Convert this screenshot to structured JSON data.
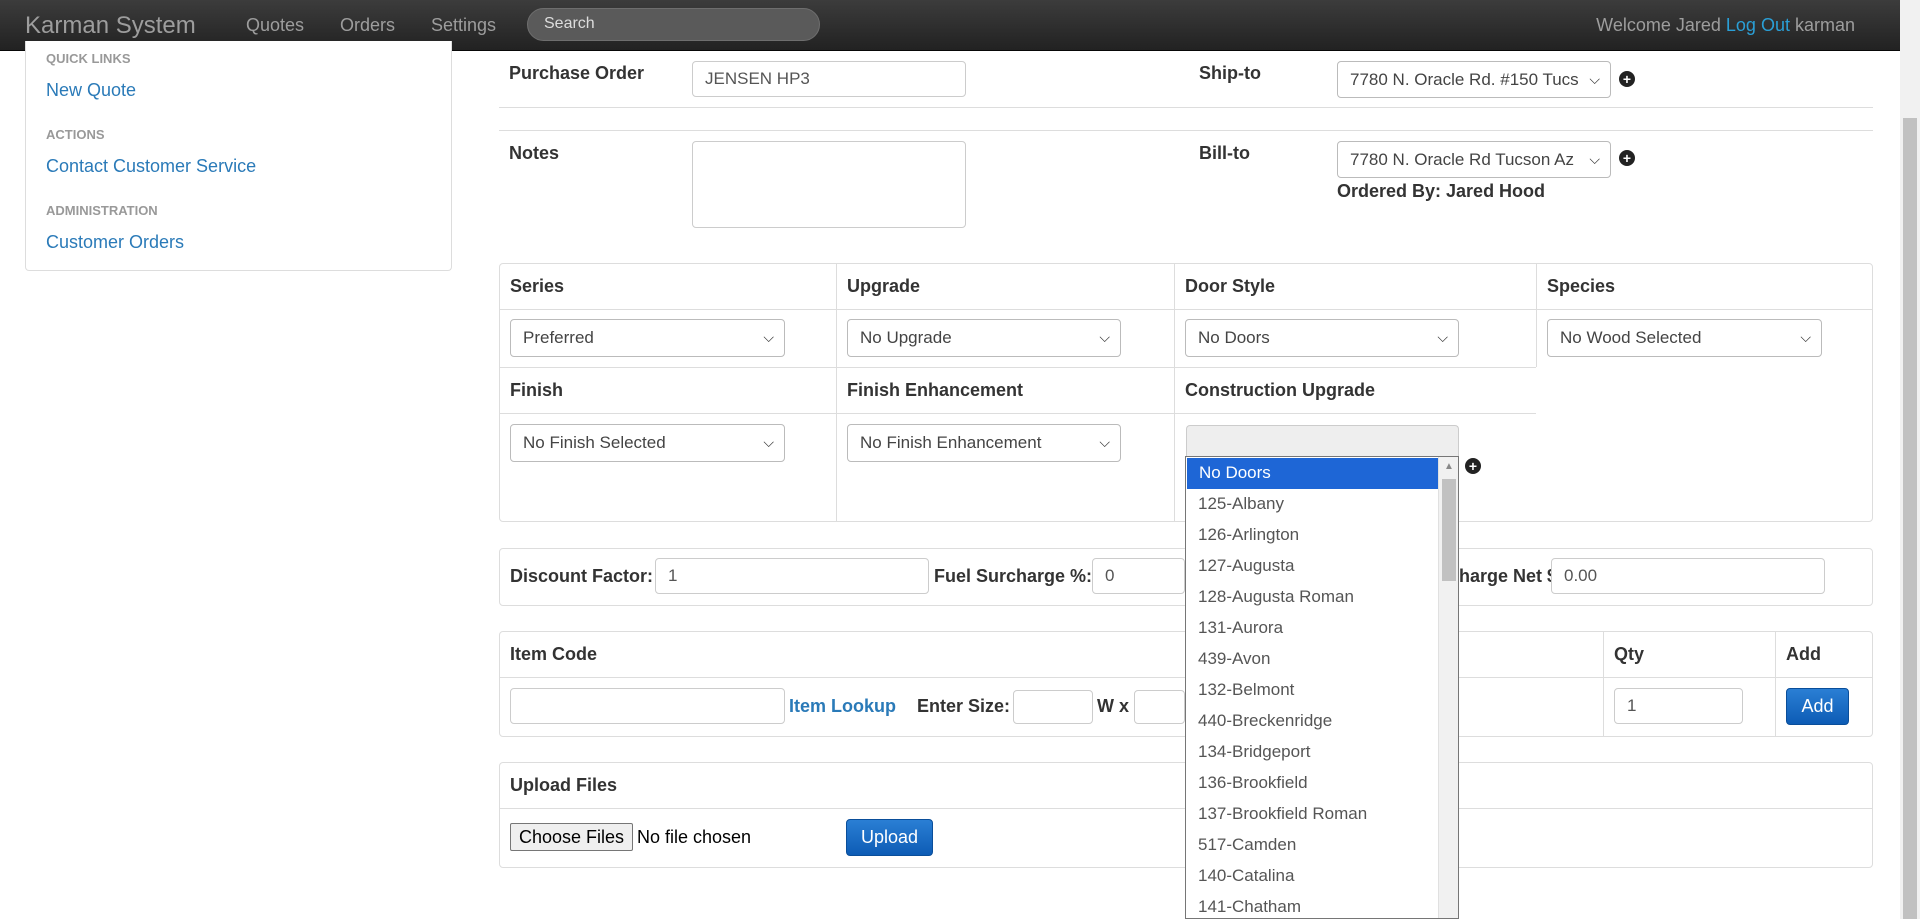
{
  "navbar": {
    "brand": "Karman System",
    "links": [
      "Quotes",
      "Orders",
      "Settings"
    ],
    "search_placeholder": "Search",
    "welcome_text": "Welcome Jared",
    "logout_label": "Log Out",
    "username": "karman"
  },
  "sidebar": {
    "quick_links_heading": "QUICK LINKS",
    "new_quote": "New Quote",
    "actions_heading": "ACTIONS",
    "contact": "Contact Customer Service",
    "admin_heading": "ADMINISTRATION",
    "customer_orders": "Customer Orders"
  },
  "order": {
    "purchase_order_label": "Purchase Order",
    "purchase_order_value": "JENSEN HP3",
    "ship_to_label": "Ship-to",
    "ship_to_value": "7780 N. Oracle Rd. #150 Tucs",
    "notes_label": "Notes",
    "notes_value": "",
    "bill_to_label": "Bill-to",
    "bill_to_value": "7780 N. Oracle Rd Tucson Az",
    "ordered_by": "Ordered By: Jared Hood"
  },
  "options": {
    "series_label": "Series",
    "series_value": "Preferred",
    "upgrade_label": "Upgrade",
    "upgrade_value": "No Upgrade",
    "door_style_label": "Door Style",
    "door_style_value": "No Doors",
    "species_label": "Species",
    "species_value": "No Wood Selected",
    "finish_label": "Finish",
    "finish_value": "No Finish Selected",
    "finish_enh_label": "Finish Enhancement",
    "finish_enh_value": "No Finish Enhancement",
    "construction_label": "Construction Upgrade"
  },
  "pricing": {
    "discount_label": "Discount Factor:",
    "discount_value": "1",
    "fuel_label": "Fuel Surcharge %:",
    "fuel_value": "0",
    "surcharge_net_label": "harge Net $",
    "surcharge_net_value": "0.00"
  },
  "items": {
    "item_code_label": "Item Code",
    "qty_label": "Qty",
    "add_label": "Add",
    "item_code_value": "",
    "item_lookup": "Item Lookup",
    "enter_size": "Enter Size:",
    "w_x": "W x",
    "qty_value": "1",
    "add_button": "Add"
  },
  "upload": {
    "heading": "Upload Files",
    "choose_files": "Choose Files",
    "no_file": "No file chosen",
    "upload_button": "Upload"
  },
  "door_dropdown": {
    "options": [
      "No Doors",
      "125-Albany",
      "126-Arlington",
      "127-Augusta",
      "128-Augusta Roman",
      "131-Aurora",
      "439-Avon",
      "132-Belmont",
      "440-Breckenridge",
      "134-Bridgeport",
      "136-Brookfield",
      "137-Brookfield Roman",
      "517-Camden",
      "140-Catalina",
      "141-Chatham"
    ],
    "selected": "No Doors"
  },
  "colors": {
    "navbar": "#222222",
    "link": "#2a7ab8",
    "primary_button": "#1565c0",
    "dropdown_selected": "#1e66d6"
  }
}
